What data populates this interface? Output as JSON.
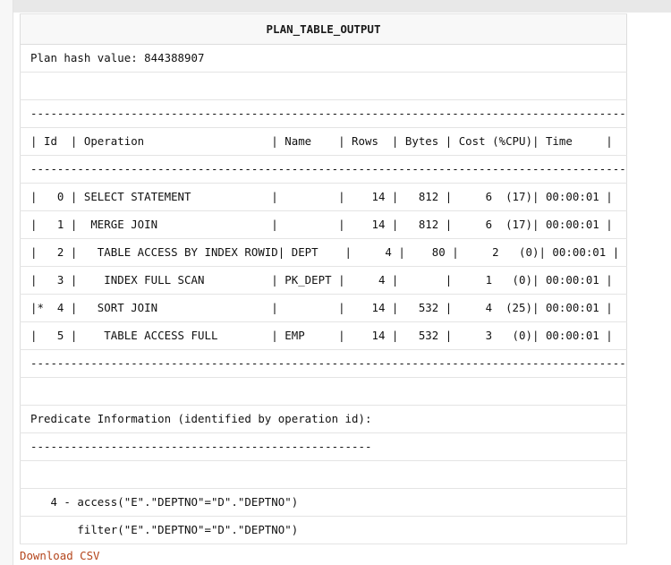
{
  "page": {
    "download_link_label": "Download CSV",
    "link_color": "#b4451c"
  },
  "table": {
    "column_header": "PLAN_TABLE_OUTPUT",
    "rows": [
      {
        "text": "Plan hash value: 844388907"
      },
      {
        "text": ""
      },
      {
        "text": "-----------------------------------------------------------------------------------------"
      },
      {
        "text": "| Id  | Operation                   | Name    | Rows  | Bytes | Cost (%CPU)| Time     |"
      },
      {
        "text": "-----------------------------------------------------------------------------------------"
      },
      {
        "text": "|   0 | SELECT STATEMENT            |         |    14 |   812 |     6  (17)| 00:00:01 |"
      },
      {
        "text": "|   1 |  MERGE JOIN                 |         |    14 |   812 |     6  (17)| 00:00:01 |"
      },
      {
        "text": "|   2 |   TABLE ACCESS BY INDEX ROWID| DEPT    |     4 |    80 |     2   (0)| 00:00:01 |"
      },
      {
        "text": "|   3 |    INDEX FULL SCAN          | PK_DEPT |     4 |       |     1   (0)| 00:00:01 |"
      },
      {
        "text": "|*  4 |   SORT JOIN                 |         |    14 |   532 |     4  (25)| 00:00:01 |"
      },
      {
        "text": "|   5 |    TABLE ACCESS FULL        | EMP     |    14 |   532 |     3   (0)| 00:00:01 |"
      },
      {
        "text": "-----------------------------------------------------------------------------------------"
      },
      {
        "text": ""
      },
      {
        "text": "Predicate Information (identified by operation id):"
      },
      {
        "text": "---------------------------------------------------"
      },
      {
        "text": ""
      },
      {
        "text": "   4 - access(\"E\".\"DEPTNO\"=\"D\".\"DEPTNO\")"
      },
      {
        "text": "       filter(\"E\".\"DEPTNO\"=\"D\".\"DEPTNO\")"
      }
    ]
  }
}
